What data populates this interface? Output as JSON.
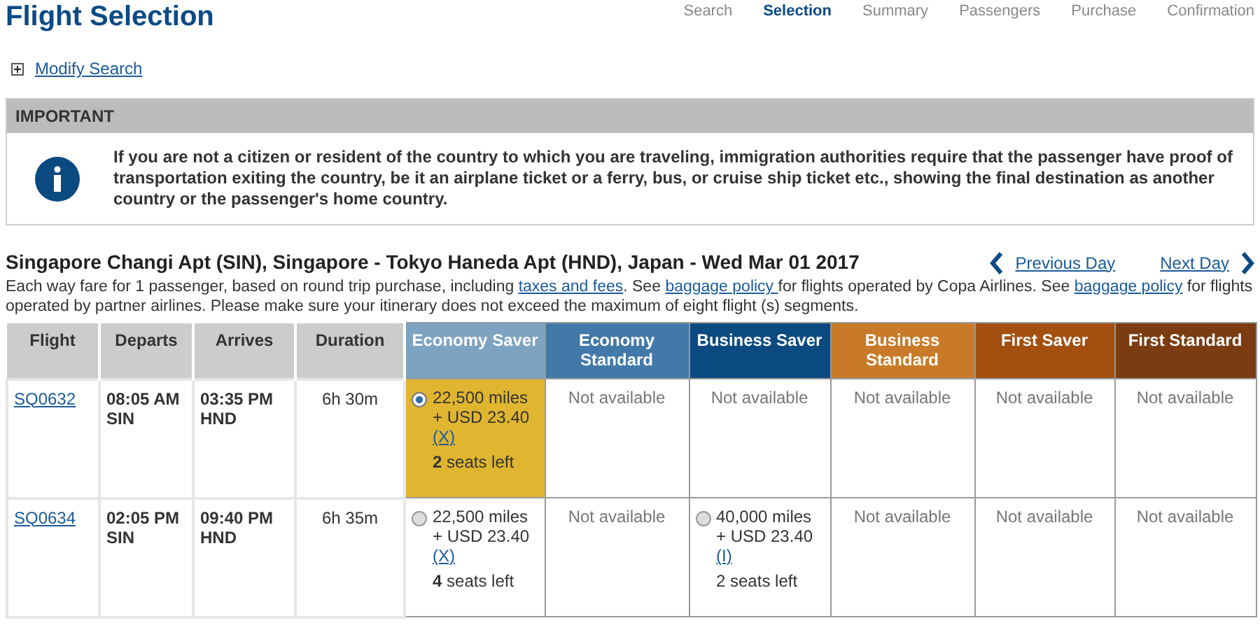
{
  "title": "Flight Selection",
  "steps": [
    {
      "label": "Search",
      "selected": false
    },
    {
      "label": "Selection",
      "selected": true
    },
    {
      "label": "Summary",
      "selected": false
    },
    {
      "label": "Passengers",
      "selected": false
    },
    {
      "label": "Purchase",
      "selected": false
    },
    {
      "label": "Confirmation",
      "selected": false
    }
  ],
  "modify_search": "Modify Search",
  "notice": {
    "heading": "IMPORTANT",
    "text": "If you are not a citizen or resident of the country to which you are traveling, immigration authorities require that the passenger have proof of transportation exiting the country, be it an airplane ticket or a ferry, bus, or cruise ship ticket etc., showing the final destination as another country or the passenger's home country."
  },
  "route": {
    "title": "Singapore Changi Apt (SIN), Singapore - Tokyo Haneda Apt (HND), Japan - Wed Mar 01 2017",
    "previous_day": "Previous Day",
    "next_day": "Next Day"
  },
  "fare_info": [
    {
      "kind": "text",
      "text": "Each way fare for 1 passenger, based on round trip purchase, including "
    },
    {
      "kind": "link",
      "text": "taxes and fees"
    },
    {
      "kind": "text",
      "text": ". See "
    },
    {
      "kind": "link",
      "text": "baggage policy "
    },
    {
      "kind": "text",
      "text": "for flights operated by Copa Airlines. See "
    },
    {
      "kind": "link",
      "text": "baggage policy"
    },
    {
      "kind": "text",
      "text": " for flights operated by partner airlines. Please make sure your itinerary does not exceed the maximum of eight flight (s) segments."
    }
  ],
  "table": {
    "columns": [
      "Flight",
      "Departs",
      "Arrives",
      "Duration"
    ],
    "cabins": [
      {
        "label": "Economy Saver",
        "color": "#7ea3c0"
      },
      {
        "label": "Economy Standard",
        "color": "#4279a8"
      },
      {
        "label": "Business Saver",
        "color": "#0b4a80"
      },
      {
        "label": "Business Standard",
        "color": "#c87a28"
      },
      {
        "label": "First Saver",
        "color": "#a34f10"
      },
      {
        "label": "First Standard",
        "color": "#7a3c10"
      }
    ],
    "rows": [
      {
        "flight": "SQ0632",
        "departs": "08:05 AM",
        "depart_code": "SIN",
        "arrives": "03:35 PM",
        "arrive_code": "HND",
        "duration": "6h 30m",
        "fares": [
          {
            "kind": "fare",
            "selected": true,
            "miles": "22,500 miles",
            "usd": "+ USD 23.40",
            "note": "(X)",
            "seats": "**2** seats left"
          },
          {
            "kind": "na",
            "text": "Not available"
          },
          {
            "kind": "na",
            "text": "Not available"
          },
          {
            "kind": "na",
            "text": "Not available"
          },
          {
            "kind": "na",
            "text": "Not available"
          },
          {
            "kind": "na",
            "text": "Not available"
          }
        ]
      },
      {
        "flight": "SQ0634",
        "departs": "02:05 PM",
        "depart_code": "SIN",
        "arrives": "09:40 PM",
        "arrive_code": "HND",
        "duration": "6h 35m",
        "fares": [
          {
            "kind": "fare",
            "selected": false,
            "miles": "22,500 miles",
            "usd": "+ USD 23.40",
            "note": "(X)",
            "seats": "**4** seats left"
          },
          {
            "kind": "na",
            "text": "Not available"
          },
          {
            "kind": "fare",
            "selected": false,
            "miles": "40,000 miles",
            "usd": "+ USD 23.40",
            "note": "(I)",
            "seats": "2 seats left"
          },
          {
            "kind": "na",
            "text": "Not available"
          },
          {
            "kind": "na",
            "text": "Not available"
          },
          {
            "kind": "na",
            "text": "Not available"
          }
        ]
      }
    ]
  }
}
